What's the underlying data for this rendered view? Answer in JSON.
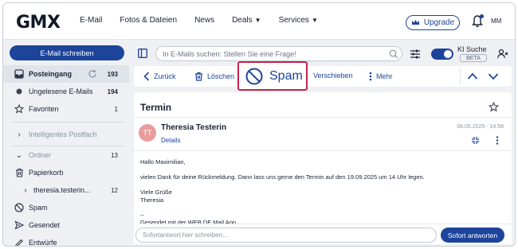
{
  "header": {
    "logo": "GMX",
    "nav": [
      "E-Mail",
      "Fotos & Dateien",
      "News",
      "Deals",
      "Services"
    ],
    "upgrade_label": "Upgrade",
    "avatar_initials": "MM"
  },
  "sidebar": {
    "compose_label": "E-Mail schreiben",
    "items": [
      {
        "label": "Posteingang",
        "count": "193",
        "icon": "inbox-icon"
      },
      {
        "label": "Ungelesene E-Mails",
        "count": "194",
        "icon": "dot-icon"
      },
      {
        "label": "Favoriten",
        "count": "1",
        "icon": "star-icon"
      },
      {
        "label": "Intelligentes Postfach",
        "count": "",
        "icon": "chevron-right-icon"
      },
      {
        "label": "Ordner",
        "count": "13",
        "icon": "chevron-down-icon"
      },
      {
        "label": "Papierkorb",
        "count": "",
        "icon": "trash-icon"
      },
      {
        "label": "theresia.testerin...",
        "count": "12",
        "icon": "chevron-right-icon"
      },
      {
        "label": "Spam",
        "count": "",
        "icon": "spam-icon"
      },
      {
        "label": "Gesendet",
        "count": "",
        "icon": "send-icon"
      },
      {
        "label": "Entwürfe",
        "count": "",
        "icon": "pen-icon"
      }
    ]
  },
  "search": {
    "placeholder": "In E-Mails suchen: Stellen Sie eine Frage!",
    "ki_label": "KI Suche",
    "beta_label": "BETA"
  },
  "toolbar": {
    "back_label": "Zurück",
    "delete_label": "Löschen",
    "spam_label": "Spam",
    "move_label": "Verschieben",
    "more_label": "Mehr"
  },
  "email": {
    "subject": "Termin",
    "sender_initials": "TT",
    "sender": "Theresia Testerin",
    "details_label": "Details",
    "date": "08.05.2025 - 14:58",
    "body": "Hallo Maximilian,\n\nvielen Dank für deine Rückmeldung. Dann lass uns gerne den Termin auf den 19.09.2025 um 14 Uhr legen.\n\nViele Grüße\nTheresia\n\n--\nGesendet mit der WEB.DE Mail App"
  },
  "reply": {
    "placeholder": "Sofortantwort hier schreiben...",
    "send_label": "Sofort antworten"
  },
  "colors": {
    "accent": "#1c449b",
    "highlight": "#c0254a",
    "avatar": "#ea9c9c"
  }
}
